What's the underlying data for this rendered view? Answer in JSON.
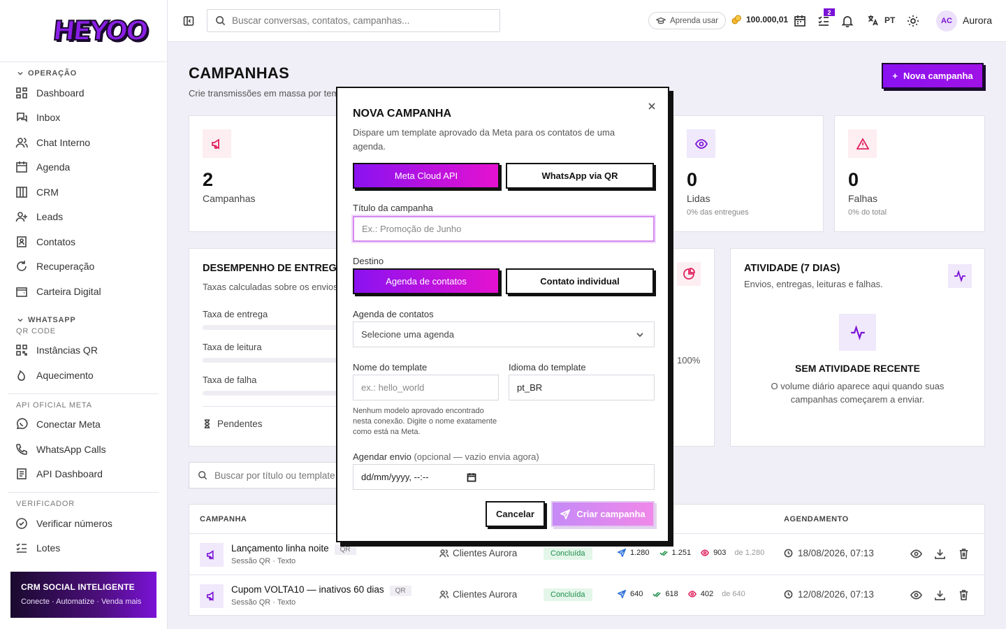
{
  "brand": {
    "logo_text": "HEYOO"
  },
  "sidebar": {
    "sections": {
      "operacao": "OPERAÇÃO",
      "whatsapp": "WHATSAPP",
      "qr_code": "QR CODE",
      "api_meta": "API OFICIAL META",
      "verificador": "VERIFICADOR"
    },
    "items": {
      "dashboard": "Dashboard",
      "inbox": "Inbox",
      "chat_interno": "Chat Interno",
      "agenda": "Agenda",
      "crm": "CRM",
      "leads": "Leads",
      "contatos": "Contatos",
      "recuperacao": "Recuperação",
      "carteira": "Carteira Digital",
      "instancias_qr": "Instâncias QR",
      "aquecimento": "Aquecimento",
      "conectar_meta": "Conectar Meta",
      "whatsapp_calls": "WhatsApp Calls",
      "api_dashboard": "API Dashboard",
      "verificar_numeros": "Verificar números",
      "lotes": "Lotes"
    },
    "promo": {
      "title": "CRM SOCIAL INTELIGENTE",
      "subtitle": "Conecte · Automatize · Venda mais"
    }
  },
  "topbar": {
    "search_placeholder": "Buscar conversas, contatos, campanhas...",
    "learn_label": "Aprenda usar",
    "coins": "100.000,01",
    "tasks_badge": "2",
    "language": "PT",
    "avatar_initials": "AC",
    "username": "Aurora"
  },
  "page": {
    "title": "CAMPANHAS",
    "subtitle": "Crie transmissões em massa por tem",
    "new_button": "Nova campanha"
  },
  "stats": {
    "campanhas": {
      "value": "2",
      "label": "Campanhas"
    },
    "lidas": {
      "value": "0",
      "label": "Lidas",
      "sub": "0% das entregues"
    },
    "falhas": {
      "value": "0",
      "label": "Falhas",
      "sub": "0% do total"
    }
  },
  "performance": {
    "title": "DESEMPENHO DE ENTREGA",
    "subtitle": "Taxas calculadas sobre os envios.",
    "rates": [
      "Taxa de entrega",
      "Taxa de leitura",
      "Taxa de falha"
    ],
    "pending": "Pendentes",
    "pct": "100%"
  },
  "activity": {
    "title": "ATIVIDADE (7 DIAS)",
    "subtitle": "Envios, entregas, leituras e falhas.",
    "empty_title": "SEM ATIVIDADE RECENTE",
    "empty_text": "O volume diário aparece aqui quando suas campanhas começarem a enviar."
  },
  "list": {
    "search_placeholder": "Buscar por título ou template...",
    "headers": {
      "campanha": "CAMPANHA",
      "agendamento": "AGENDAMENTO"
    },
    "rows": [
      {
        "name": "Lançamento linha noite",
        "tag": "QR",
        "meta": "Sessão QR · Texto",
        "dest": "Clientes Aurora",
        "status": "Concluída",
        "sent": "1.280",
        "delivered": "1.251",
        "read": "903",
        "of": "de 1.280",
        "date": "18/08/2026, 07:13"
      },
      {
        "name": "Cupom VOLTA10 — inativos 60 dias",
        "tag": "QR",
        "meta": "Sessão QR · Texto",
        "dest": "Clientes Aurora",
        "status": "Concluída",
        "sent": "640",
        "delivered": "618",
        "read": "402",
        "of": "de 640",
        "date": "12/08/2026, 07:13"
      }
    ]
  },
  "modal": {
    "title": "NOVA CAMPANHA",
    "subtitle": "Dispare um template aprovado da Meta para os contatos de uma agenda.",
    "channel_options": [
      "Meta Cloud API",
      "WhatsApp via QR"
    ],
    "title_label": "Título da campanha",
    "title_placeholder": "Ex.: Promoção de Junho",
    "destino_label": "Destino",
    "destino_options": [
      "Agenda de contatos",
      "Contato individual"
    ],
    "agenda_label": "Agenda de contatos",
    "agenda_value": "Selecione uma agenda",
    "template_label": "Nome do template",
    "template_placeholder": "ex.: hello_world",
    "idioma_label": "Idioma do template",
    "idioma_value": "pt_BR",
    "template_hint": "Nenhum modelo aprovado encontrado nesta conexão. Digite o nome exatamente como está na Meta.",
    "schedule_label": "Agendar envio",
    "schedule_optional": "(opcional — vazio envia agora)",
    "schedule_value": "dd/mm/yyyy, --:--",
    "cancel": "Cancelar",
    "create": "Criar campanha"
  }
}
